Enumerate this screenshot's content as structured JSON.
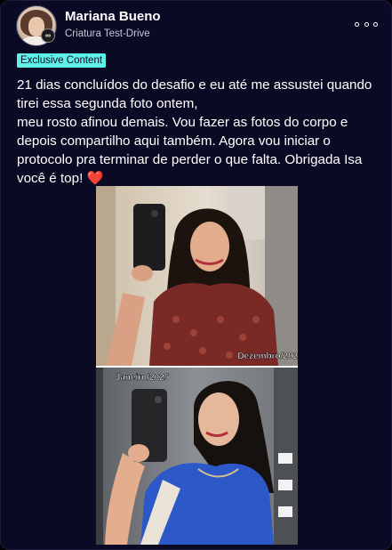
{
  "post": {
    "author": {
      "name": "Mariana Bueno",
      "subtitle": "Criatura Test-Drive"
    },
    "tag": "Exclusive Content",
    "text": "21 dias concluídos do desafio e eu até me assustei quando tirei essa segunda foto ontem,\nmeu rosto afinou demais. Vou fazer as fotos do corpo e depois compartilho aqui também. Agora vou iniciar o protocolo pra terminar de perder o que falta. Obrigada Isa você é top!",
    "emoji": "❤️",
    "photo": {
      "label_top": "Dezembro/2024",
      "label_bottom": "Janeiro/2025"
    }
  },
  "icons": {
    "more": "more-horizontal-icon",
    "badge": "infinity-badge-icon"
  },
  "colors": {
    "background": "#0b0a24",
    "tag_background": "#5ef2e8",
    "heart": "#e5343f"
  }
}
